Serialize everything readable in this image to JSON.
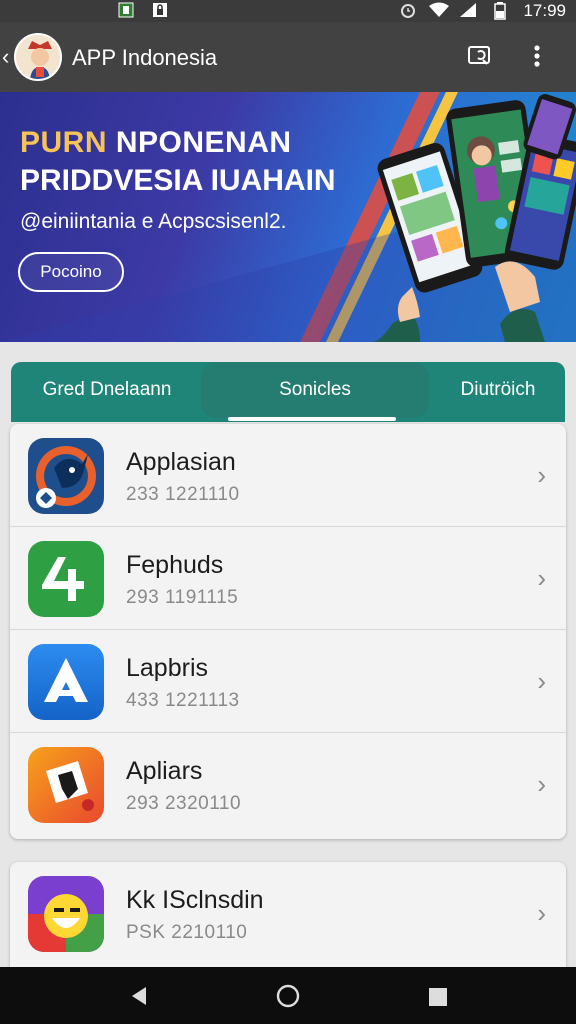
{
  "status_bar": {
    "time": "17:99"
  },
  "app_bar": {
    "title": "APP Indonesia"
  },
  "banner": {
    "headline_accent": "PURN",
    "headline_rest": " NPONENAN",
    "headline_line2": "PRIDDVESIA IUAHAIN",
    "subtitle": "@einiintania e Acpscsisenl2.",
    "cta_label": "Pocoino"
  },
  "tabs": [
    {
      "label": "Gred Dnelaann"
    },
    {
      "label": "Sonicles"
    },
    {
      "label": "Diutröich"
    }
  ],
  "apps": [
    {
      "name": "Applasian",
      "meta": "233 1221110"
    },
    {
      "name": "Fephuds",
      "meta": "293 1191115"
    },
    {
      "name": "Lapbris",
      "meta": "433 1221113"
    },
    {
      "name": "Apliars",
      "meta": "293 2320110"
    },
    {
      "name": "Kk ISclnsdin",
      "meta": "PSK 2210110"
    }
  ],
  "colors": {
    "app_bar": "#424242",
    "tabs": "#1f8578",
    "banner_start": "#2c2f8f",
    "banner_end": "#1b8fd0"
  }
}
